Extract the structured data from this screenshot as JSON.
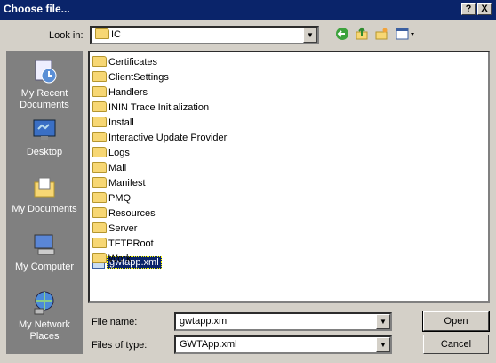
{
  "titlebar": {
    "title": "Choose file...",
    "help": "?",
    "close": "X"
  },
  "toolbar": {
    "lookin_label": "Look in:",
    "lookin_value": "IC"
  },
  "places": [
    {
      "label": "My Recent Documents",
      "icon": "recent-documents-icon"
    },
    {
      "label": "Desktop",
      "icon": "desktop-icon"
    },
    {
      "label": "My Documents",
      "icon": "my-documents-icon"
    },
    {
      "label": "My Computer",
      "icon": "my-computer-icon"
    },
    {
      "label": "My Network Places",
      "icon": "network-places-icon"
    }
  ],
  "files": [
    "Certificates",
    "ClientSettings",
    "Handlers",
    "ININ Trace Initialization",
    "Install",
    "Interactive Update Provider",
    "Logs",
    "Mail",
    "Manifest",
    "PMQ",
    "Resources",
    "Server",
    "TFTPRoot",
    "Work"
  ],
  "selected_file": "gwtapp.xml",
  "form": {
    "file_name_label": "File name:",
    "file_name_value": "gwtapp.xml",
    "file_type_label": "Files of type:",
    "file_type_value": "GWTApp.xml",
    "open_label": "Open",
    "cancel_label": "Cancel"
  }
}
